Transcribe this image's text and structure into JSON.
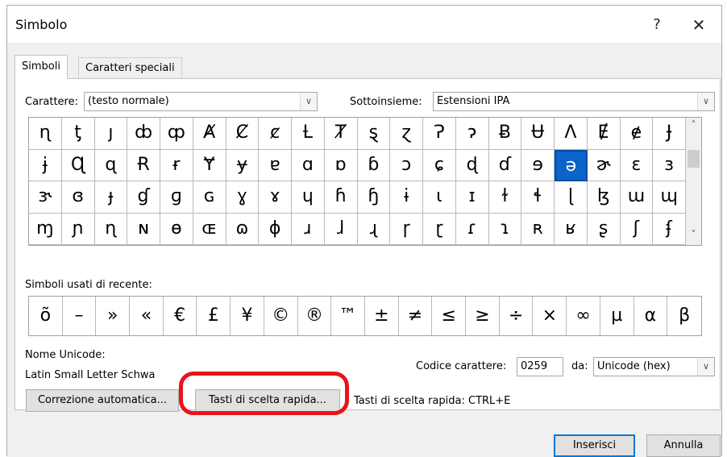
{
  "window": {
    "title": "Simbolo",
    "help_glyph": "?",
    "close_glyph": "✕"
  },
  "tabs": [
    {
      "label": "Simboli",
      "active": true
    },
    {
      "label": "Caratteri speciali",
      "active": false
    }
  ],
  "font": {
    "label": "Carattere:",
    "value": "(testo normale)"
  },
  "subset": {
    "label": "Sottoinsieme:",
    "value": "Estensioni IPA"
  },
  "symbol_grid": {
    "rows": [
      [
        "ɳ",
        "ƫ",
        "ȷ",
        "ȸ",
        "ȹ",
        "Ⱥ",
        "Ȼ",
        "ȼ",
        "Ƚ",
        "Ⱦ",
        "ȿ",
        "ɀ",
        "Ɂ",
        "ɂ",
        "Ƀ",
        "Ʉ",
        "Ʌ",
        "Ɇ",
        "ɇ",
        "Ɉ"
      ],
      [
        "ɉ",
        "Ɋ",
        "ɋ",
        "Ɍ",
        "ɍ",
        "Ɏ",
        "ɏ",
        "ɐ",
        "ɑ",
        "ɒ",
        "ɓ",
        "ɔ",
        "ɕ",
        "ɖ",
        "ɗ",
        "ɘ",
        "ə",
        "ɚ",
        "ɛ",
        "ɜ"
      ],
      [
        "ɝ",
        "ɞ",
        "ɟ",
        "ɠ",
        "ɡ",
        "ɢ",
        "ɣ",
        "ɤ",
        "ɥ",
        "ɦ",
        "ɧ",
        "ɨ",
        "ɩ",
        "ɪ",
        "ɫ",
        "ɬ",
        "ɭ",
        "ɮ",
        "ɯ",
        "ɰ"
      ],
      [
        "ɱ",
        "ɲ",
        "ɳ",
        "ɴ",
        "ɵ",
        "ɶ",
        "ɷ",
        "ɸ",
        "ɹ",
        "ɺ",
        "ɻ",
        "ɼ",
        "ɽ",
        "ɾ",
        "ɿ",
        "ʀ",
        "ʁ",
        "ʂ",
        "ʃ",
        "ʄ"
      ]
    ],
    "selected": {
      "row": 1,
      "col": 16
    }
  },
  "recent": {
    "label": "Simboli usati di recente:",
    "symbols": [
      "õ",
      "–",
      "»",
      "«",
      "€",
      "£",
      "¥",
      "©",
      "®",
      "™",
      "±",
      "≠",
      "≤",
      "≥",
      "÷",
      "×",
      "∞",
      "µ",
      "α",
      "β"
    ]
  },
  "unicode_name": {
    "label": "Nome Unicode:",
    "value": "Latin Small Letter Schwa"
  },
  "char_code": {
    "label": "Codice carattere:",
    "value": "0259"
  },
  "from": {
    "label": "da:",
    "value": "Unicode (hex)"
  },
  "buttons": {
    "autocorrect": "Correzione automatica...",
    "shortcut_key": "Tasti di scelta rapida...",
    "insert": "Inserisci",
    "cancel": "Annulla"
  },
  "shortcut_text": "Tasti di scelta rapida: CTRL+E",
  "colors": {
    "selection": "#0a64c9",
    "highlight": "#e8141a",
    "primary_border": "#0078d7"
  },
  "icons": {
    "dropdown": "chevron-down-icon",
    "scroll_up": "chevron-up-icon",
    "scroll_down": "chevron-down-icon"
  }
}
